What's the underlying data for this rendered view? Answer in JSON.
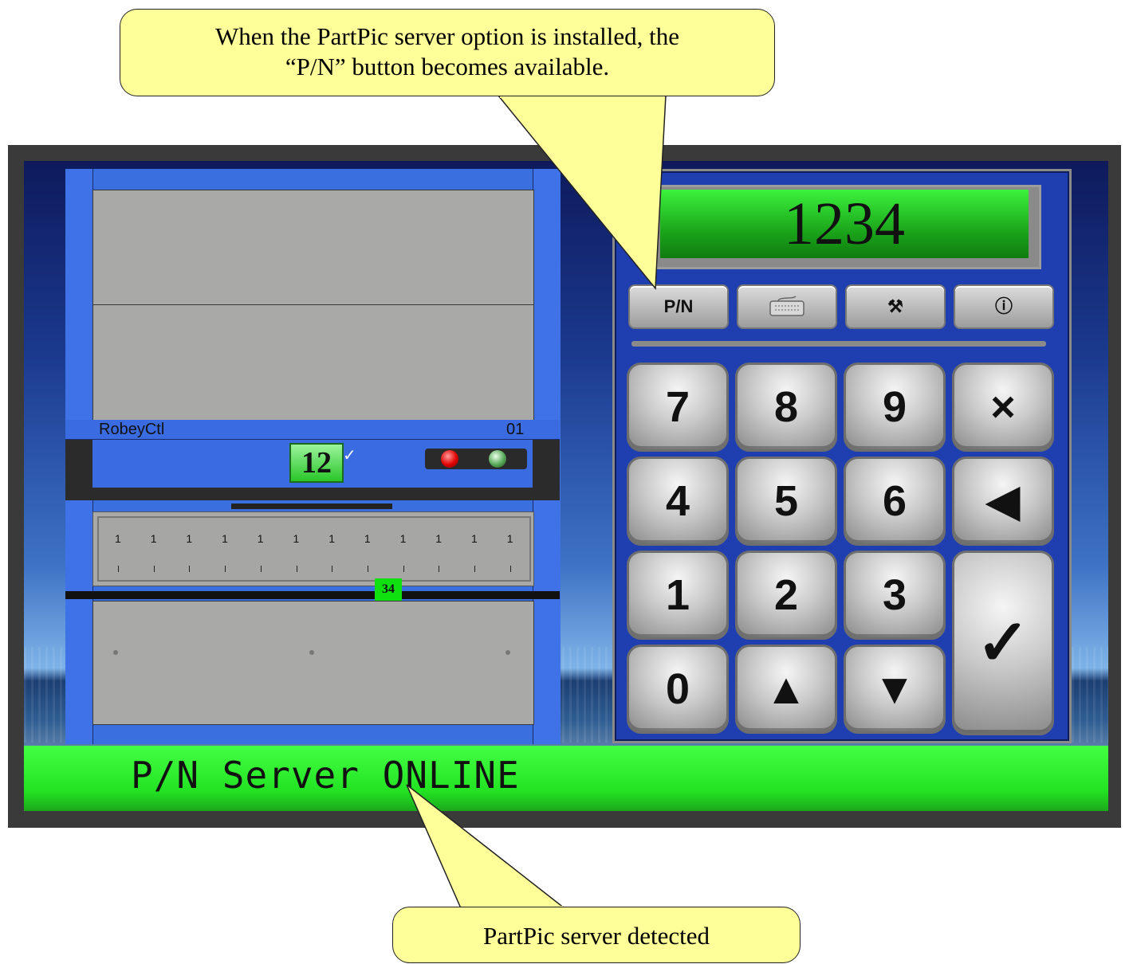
{
  "callouts": {
    "top_line1": "When the PartPic server option is installed, the",
    "top_line2": "“P/N” button becomes available.",
    "bottom": "PartPic server detected"
  },
  "carousel": {
    "controller_name": "RobeyCtl",
    "controller_number": "01",
    "current_position": "12",
    "check_mark": "✓",
    "slot_label": "34",
    "ticks": [
      "1",
      "1",
      "1",
      "1",
      "1",
      "1",
      "1",
      "1",
      "1",
      "1",
      "1",
      "1"
    ]
  },
  "keypad": {
    "display_value": "1234",
    "function_buttons": [
      {
        "label": "P/N",
        "icon": "pn-text"
      },
      {
        "label": "",
        "icon": "keyboard-icon"
      },
      {
        "label": "⚒",
        "icon": "tools-icon"
      },
      {
        "label": "ⓘ",
        "icon": "info-icon"
      }
    ],
    "keys": {
      "k7": "7",
      "k8": "8",
      "k9": "9",
      "clear": "×",
      "k4": "4",
      "k5": "5",
      "k6": "6",
      "back": "◀",
      "k1": "1",
      "k2": "2",
      "k3": "3",
      "enter": "✓",
      "k0": "0",
      "up": "▲",
      "down": "▼"
    }
  },
  "status": {
    "text": "P/N Server ONLINE",
    "color": "#22e222"
  },
  "colors": {
    "callout": "#ffff99",
    "panel_blue": "#1f3fb0",
    "display_green": "#1ba61b"
  }
}
